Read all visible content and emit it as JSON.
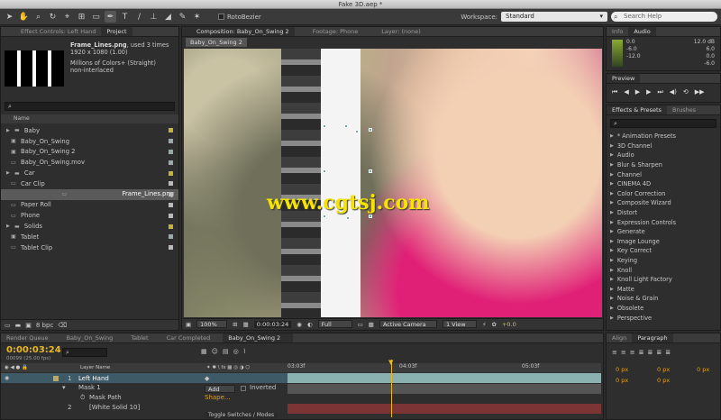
{
  "window_title": "Fake 3D.aep *",
  "toolbar": {
    "rotobezier_label": "RotoBezier",
    "workspace_label": "Workspace:",
    "workspace_value": "Standard",
    "search_placeholder": "Search Help"
  },
  "project_panel": {
    "tab_effect_controls": "Effect Controls: Left Hand",
    "tab_project": "Project",
    "file_name": "Frame_Lines.png",
    "used_times": ", used 3 times",
    "dimensions": "1920 x 1080 (1.00)",
    "colors": "Millions of Colors+ (Straight)",
    "interlace": "non-interlaced",
    "name_header": "Name",
    "bpc": "8 bpc",
    "items": [
      {
        "label": "Baby",
        "icon": "folder-icon"
      },
      {
        "label": "Baby_On_Swing",
        "icon": "composition-icon"
      },
      {
        "label": "Baby_On_Swing 2",
        "icon": "composition-icon"
      },
      {
        "label": "Baby_On_Swing.mov",
        "icon": "footage-icon"
      },
      {
        "label": "Car",
        "icon": "folder-icon"
      },
      {
        "label": "Car Clip",
        "icon": "footage-icon"
      },
      {
        "label": "Frame_Lines.png",
        "icon": "image-icon"
      },
      {
        "label": "Paper Roll",
        "icon": "image-icon"
      },
      {
        "label": "Phone",
        "icon": "image-icon"
      },
      {
        "label": "Solids",
        "icon": "folder-icon"
      },
      {
        "label": "Tablet",
        "icon": "composition-icon"
      },
      {
        "label": "Tablet Clip",
        "icon": "footage-icon"
      }
    ]
  },
  "composition_panel": {
    "tab_composition": "Composition: Baby_On_Swing 2",
    "tab_footage": "Footage: Phone",
    "tab_layer": "Layer: (none)",
    "comp_tab": "Baby_On_Swing 2",
    "watermark": "www.cgtsj.com",
    "zoom": "100%",
    "timecode": "0:00:03:24",
    "resolution": "Full",
    "camera": "Active Camera",
    "view": "1 View",
    "exposure": "+0.0"
  },
  "info_panel": {
    "tab_info": "Info",
    "tab_audio": "Audio",
    "levels_left": [
      "0.0",
      "-6.0",
      "-12.0"
    ],
    "levels_right": [
      "12.0 dB",
      "6.0",
      "0.0",
      "-6.0"
    ]
  },
  "preview_panel": {
    "title": "Preview"
  },
  "effects_panel": {
    "tab_effects": "Effects & Presets",
    "tab_brushes": "Brushes",
    "categories": [
      "* Animation Presets",
      "3D Channel",
      "Audio",
      "Blur & Sharpen",
      "Channel",
      "CINEMA 4D",
      "Color Correction",
      "Composite Wizard",
      "Distort",
      "Expression Controls",
      "Generate",
      "Image Lounge",
      "Key Correct",
      "Keying",
      "Knoll",
      "Knoll Light Factory",
      "Matte",
      "Noise & Grain",
      "Obsolete",
      "Perspective"
    ]
  },
  "timeline": {
    "tabs": [
      "Render Queue",
      "Baby_On_Swing",
      "Tablet",
      "Car Completed",
      "Baby_On_Swing 2"
    ],
    "timecode": "0:00:03:24",
    "frames": "00099 (25.00 fps)",
    "layer_name_header": "Layer Name",
    "ruler": [
      "03:03f",
      "04:03f",
      "05:03f"
    ],
    "layers": [
      {
        "num": "1",
        "name": "Left Hand"
      },
      {
        "name": "Mask 1",
        "mode": "Add",
        "inverted": "Inverted"
      },
      {
        "name": "Mask Path",
        "value": "Shape..."
      },
      {
        "num": "2",
        "name": "[White Solid 10]"
      }
    ],
    "toggle_label": "Toggle Switches / Modes"
  },
  "paragraph_panel": {
    "tab_align": "Align",
    "tab_paragraph": "Paragraph",
    "values": [
      "0 px",
      "0 px",
      "0 px",
      "0 px",
      "0 px"
    ]
  }
}
